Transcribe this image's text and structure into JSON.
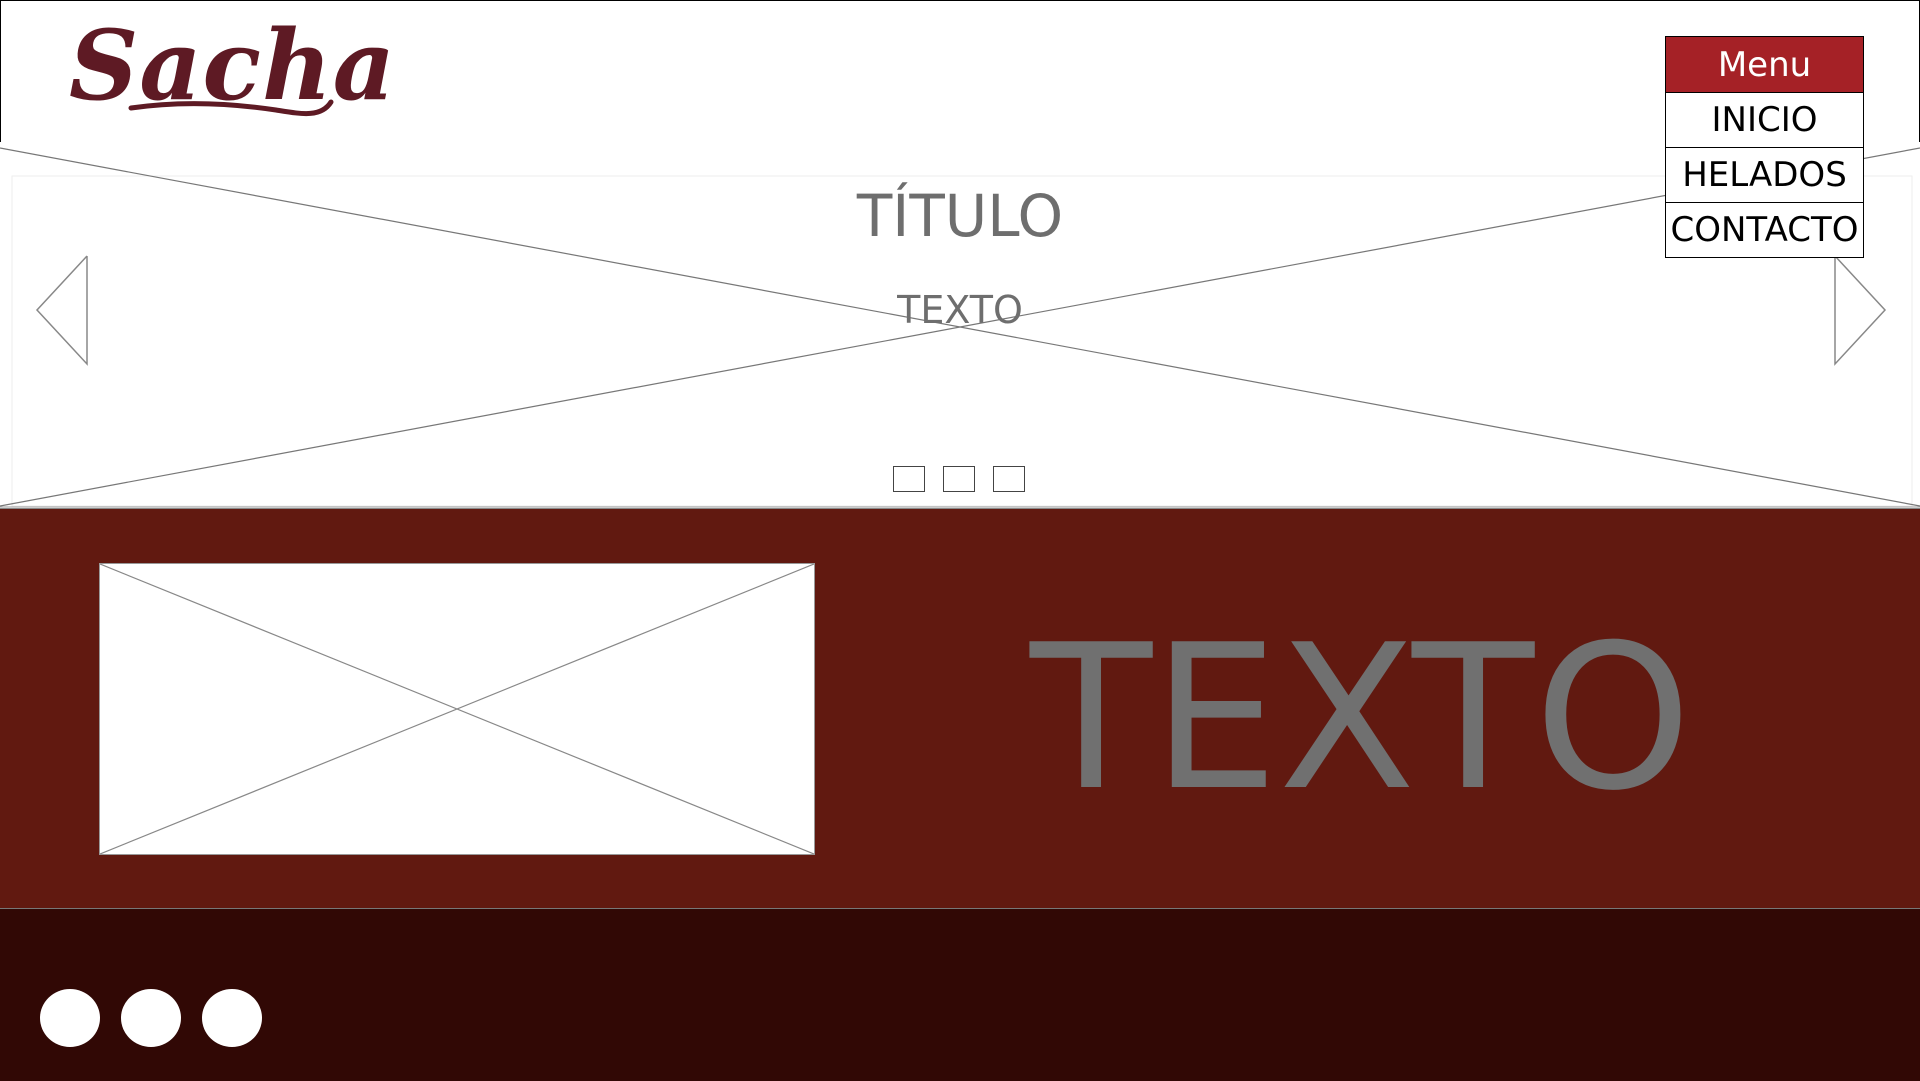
{
  "header": {
    "logo_text": "Sacha"
  },
  "menu": {
    "title": "Menu",
    "items": [
      {
        "label": "INICIO"
      },
      {
        "label": "HELADOS"
      },
      {
        "label": "CONTACTO"
      }
    ]
  },
  "hero": {
    "title": "TÍTULO",
    "text": "TEXTO",
    "slide_count": 3
  },
  "feature": {
    "text": "TEXTO"
  },
  "colors": {
    "brand": "#5e1a24",
    "menu_header": "#a52126",
    "feature_bg": "#611910",
    "footer_bg": "#310805"
  },
  "icons": {
    "prev": "chevron-left-icon",
    "next": "chevron-right-icon",
    "social": [
      "circle-icon",
      "circle-icon",
      "circle-icon"
    ]
  }
}
